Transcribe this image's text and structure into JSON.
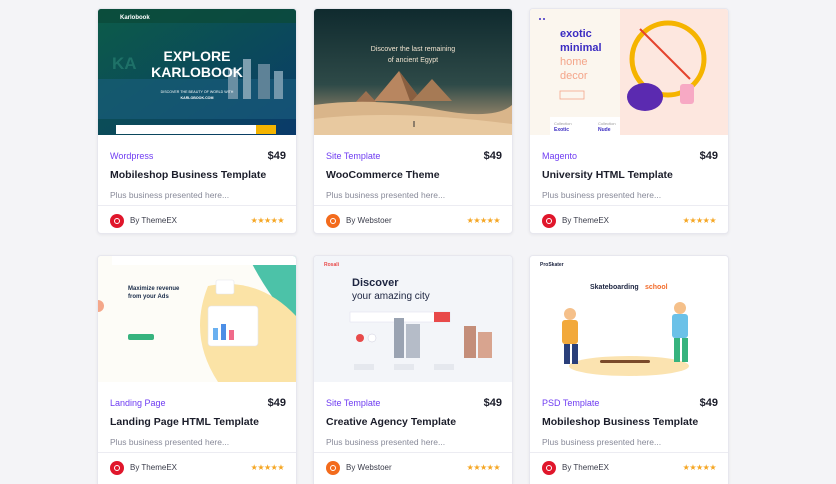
{
  "cards": [
    {
      "category": "Wordpress",
      "price": "$49",
      "title": "Mobileshop Business Template",
      "desc": "Plus business presented here...",
      "author": "By ThemeEX",
      "stars": "★★★★★",
      "thumb": {
        "logo": "Karlobook",
        "headline1": "EXPLORE",
        "headline2": "KARLOBOOK",
        "sub": "DISCOVER THE BEAUTY OF WORLD WITH",
        "site": "KARLOBOOK.COM"
      }
    },
    {
      "category": "Site Template",
      "price": "$49",
      "title": "WooCommerce Theme",
      "desc": "Plus business presented here...",
      "author": "By Webstoer",
      "stars": "★★★★★",
      "thumb": {
        "headline1": "Discover the last remaining",
        "headline2": "of ancient Egypt"
      }
    },
    {
      "category": "Magento",
      "price": "$49",
      "title": "University HTML Template",
      "desc": "Plus business presented here...",
      "author": "By ThemeEX",
      "stars": "★★★★★",
      "thumb": {
        "w1": "exotic",
        "w2": "minimal",
        "w3": "home",
        "w4": "decor",
        "tag1": "Collection",
        "tag1b": "Exotic",
        "tag2": "Collection",
        "tag2b": "Nude"
      }
    },
    {
      "category": "Landing Page",
      "price": "$49",
      "title": "Landing Page HTML Template",
      "desc": "Plus business presented here...",
      "author": "By ThemeEX",
      "stars": "★★★★★",
      "thumb": {
        "headline1": "Maximize revenue",
        "headline2": "from your Ads"
      }
    },
    {
      "category": "Site Template",
      "price": "$49",
      "title": "Creative Agency Template",
      "desc": "Plus business presented here...",
      "author": "By Webstoer",
      "stars": "★★★★★",
      "thumb": {
        "logo": "Rosali",
        "headline1": "Discover",
        "headline2": "your amazing city"
      }
    },
    {
      "category": "PSD Template",
      "price": "$49",
      "title": "Mobileshop Business Template",
      "desc": "Plus business presented here...",
      "author": "By ThemeEX",
      "stars": "★★★★★",
      "thumb": {
        "logo": "ProSkater",
        "headline1": "Skateboarding",
        "headline2": "school"
      }
    }
  ]
}
